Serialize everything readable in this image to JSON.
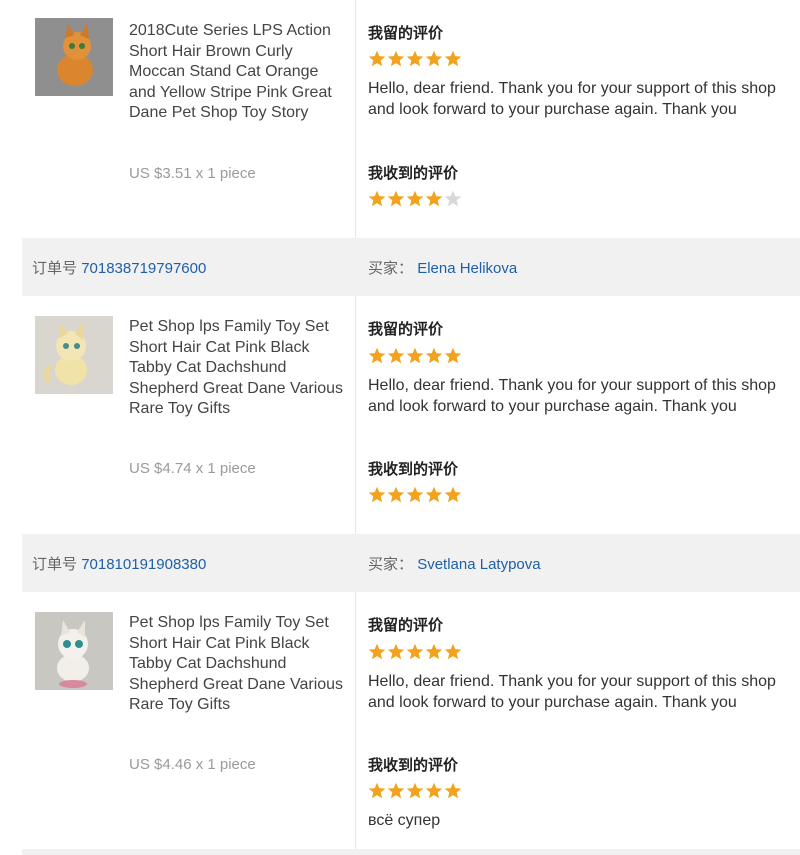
{
  "labels": {
    "my_review": "我留的评价",
    "received_review": "我收到的评价",
    "order_no": "订单号",
    "buyer": "买家："
  },
  "orders": [
    {
      "order_number": "",
      "buyer_name": "",
      "item": {
        "title": "2018Cute Series LPS Action Short Hair Brown Curly Moccan Stand Cat Orange and Yellow Stripe Pink Great Dane Pet Shop Toy Story",
        "price": "US $3.51 x 1 piece",
        "thumb_color": "#d88a3a",
        "my_review_stars": 5,
        "my_review_text": "Hello, dear friend. Thank you for your support of this shop and look forward to your purchase again. Thank you",
        "received_stars": 4,
        "received_text": ""
      }
    },
    {
      "order_number": "701838719797600",
      "buyer_name": "Elena Helikova",
      "item": {
        "title": "Pet Shop lps Family Toy Set Short Hair Cat Pink Black Tabby Cat Dachshund Shepherd Great Dane Various Rare Toy Gifts",
        "price": "US $4.74 x 1 piece",
        "thumb_color": "#efe3b0",
        "my_review_stars": 5,
        "my_review_text": "Hello, dear friend. Thank you for your support of this shop and look forward to your purchase again. Thank you",
        "received_stars": 5,
        "received_text": ""
      }
    },
    {
      "order_number": "701810191908380",
      "buyer_name": "Svetlana Latypova",
      "item": {
        "title": "Pet Shop lps Family Toy Set Short Hair Cat Pink Black Tabby Cat Dachshund Shepherd Great Dane Various Rare Toy Gifts",
        "price": "US $4.46 x 1 piece",
        "thumb_color": "#e6e6e2",
        "my_review_stars": 5,
        "my_review_text": "Hello, dear friend. Thank you for your support of this shop and look forward to your purchase again. Thank you",
        "received_stars": 5,
        "received_text": "всё супер"
      }
    }
  ],
  "colors": {
    "accent_star": "#f2a21c",
    "link": "#1f5fa8",
    "header_bg": "#f1f1f1"
  }
}
